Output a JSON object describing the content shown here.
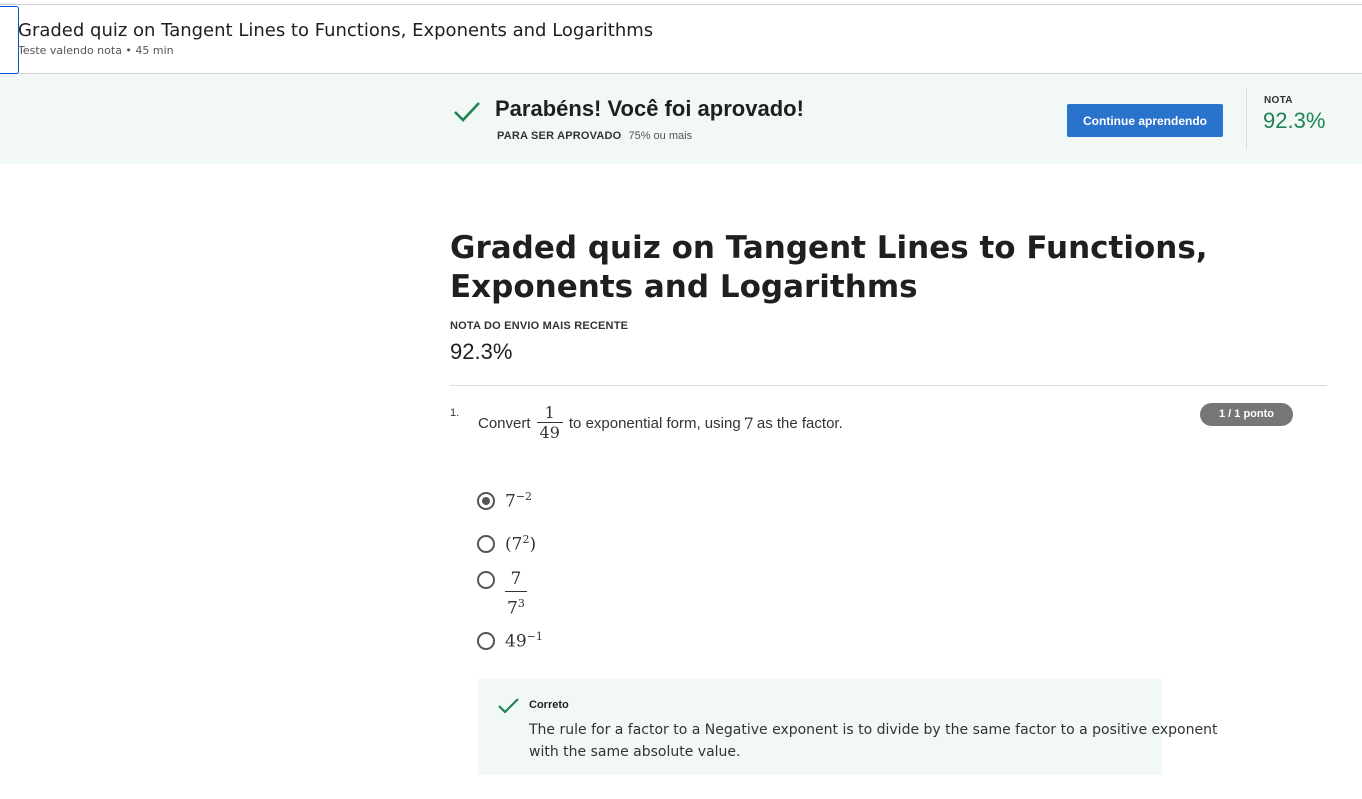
{
  "header": {
    "title": "Graded quiz on Tangent Lines to Functions, Exponents and Logarithms",
    "subtitle": "Teste valendo nota • 45 min"
  },
  "banner": {
    "message": "Parabéns! Você foi aprovado!",
    "requirement_label": "PARA SER APROVADO",
    "requirement_value": "75% ou mais",
    "continue_label": "Continue aprendendo",
    "grade_label": "NOTA",
    "grade_value": "92.3%",
    "accent_color": "#1f8354",
    "button_color": "#2a73cc"
  },
  "main": {
    "title": "Graded quiz on Tangent Lines to Functions, Exponents and Logarithms",
    "recent_label": "NOTA DO ENVIO MAIS RECENTE",
    "recent_value": "92.3%"
  },
  "question": {
    "number": "1.",
    "text_before": "Convert",
    "fraction_num": "1",
    "fraction_den": "49",
    "text_middle": "to exponential form, using",
    "factor": "7",
    "text_after": "as the factor.",
    "points": "1 / 1 ponto",
    "options": [
      {
        "base": "7",
        "exp": "−2",
        "selected": true
      },
      {
        "open": "(7",
        "exp": "2",
        "close": ")",
        "selected": false
      },
      {
        "num": "7",
        "den_base": "7",
        "den_exp": "3",
        "selected": false
      },
      {
        "base": "49",
        "exp": "−1",
        "selected": false
      }
    ]
  },
  "feedback": {
    "status": "Correto",
    "text": "The rule for a factor to a Negative exponent is to divide by the same factor to a positive exponent with the same absolute value."
  }
}
